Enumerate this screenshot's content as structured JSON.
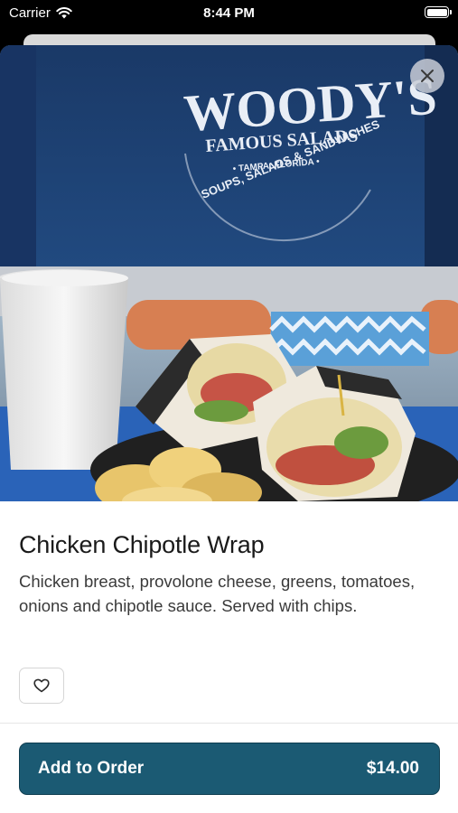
{
  "status_bar": {
    "carrier": "Carrier",
    "time": "8:44 PM"
  },
  "hero_sign": {
    "name": "WOODY'S",
    "subtitle": "FAMOUS SALADS",
    "location": "• TAMPA, FLORIDA •",
    "tagline": "SOUPS, SALADS & SANDWICHES"
  },
  "item": {
    "title": "Chicken Chipotle Wrap",
    "description": "Chicken breast, provolone cheese, greens, tomatoes, onions and chipotle sauce. Served with chips."
  },
  "order_button": {
    "label": "Add to Order",
    "price": "$14.00"
  },
  "colors": {
    "primary": "#1b5a73",
    "hero_wall": "#1d3f70"
  },
  "icons": {
    "close": "close-icon",
    "favorite": "heart-outline-icon",
    "wifi": "wifi-icon",
    "battery": "battery-icon"
  }
}
